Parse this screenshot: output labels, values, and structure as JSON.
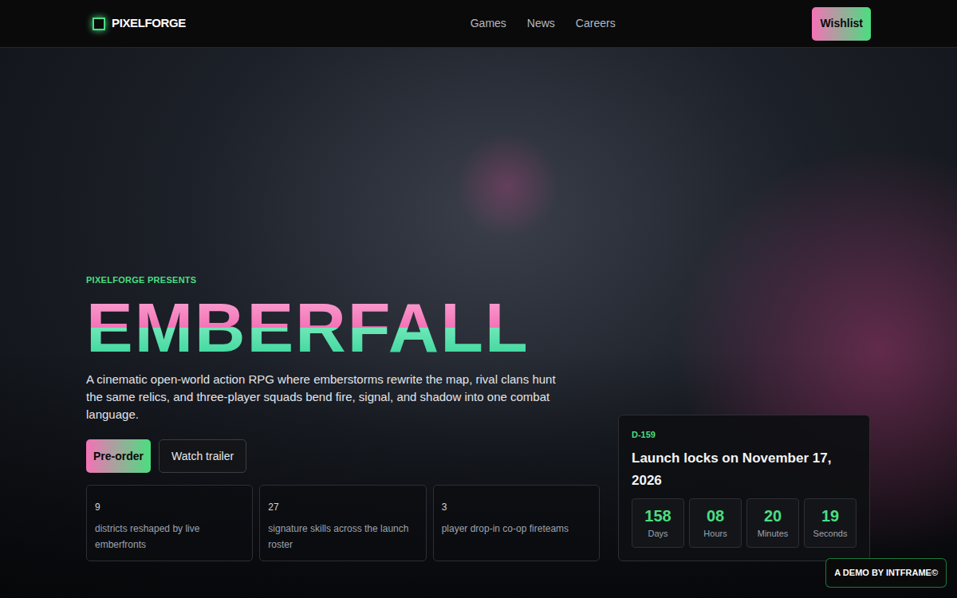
{
  "brand": {
    "name": "PIXELFORGE"
  },
  "nav": {
    "links": [
      "Games",
      "News",
      "Careers"
    ],
    "cta": "Wishlist"
  },
  "hero": {
    "eyebrow": "PIXELFORGE PRESENTS",
    "title": "EMBERFALL",
    "description": "A cinematic open-world action RPG where emberstorms rewrite the map, rival clans hunt the same relics, and three-player squads bend fire, signal, and shadow into one combat language.",
    "buttons": [
      {
        "label": "Pre-order",
        "kind": "primary"
      },
      {
        "label": "Watch trailer",
        "kind": "secondary"
      }
    ],
    "stats": [
      {
        "value": "9",
        "label": "districts reshaped by live emberfronts"
      },
      {
        "value": "27",
        "label": "signature skills across the launch roster"
      },
      {
        "value": "3",
        "label": "player drop-in co-op fireteams"
      }
    ]
  },
  "countdown": {
    "tag": "D-159",
    "title": "Launch locks on November 17, 2026",
    "units": [
      {
        "value": "158",
        "label": "Days"
      },
      {
        "value": "08",
        "label": "Hours"
      },
      {
        "value": "20",
        "label": "Minutes"
      },
      {
        "value": "19",
        "label": "Seconds"
      }
    ]
  },
  "badge": "A DEMO BY INTFRAME©"
}
